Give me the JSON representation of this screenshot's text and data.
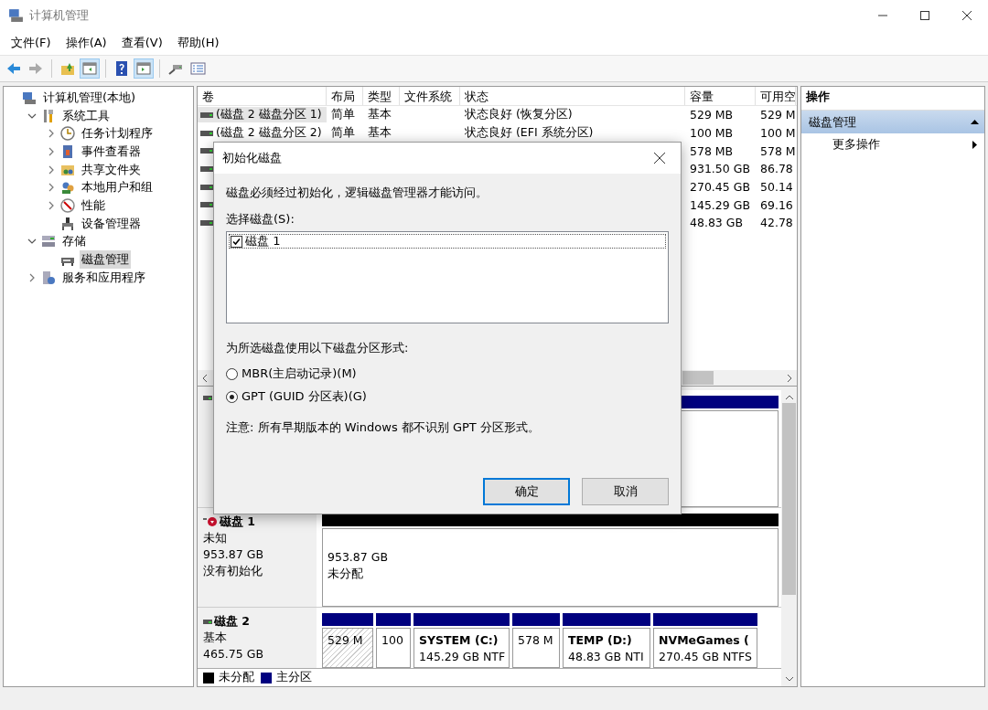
{
  "window": {
    "title": "计算机管理"
  },
  "menu": [
    "文件(F)",
    "操作(A)",
    "查看(V)",
    "帮助(H)"
  ],
  "toolbar": [
    {
      "disabled": false,
      "pressed": false
    },
    {
      "disabled": true,
      "pressed": false
    },
    {
      "disabled": false,
      "pressed": false
    },
    {
      "disabled": false,
      "pressed": true
    },
    {
      "disabled": false,
      "pressed": false
    },
    {
      "disabled": false,
      "pressed": true
    },
    {
      "disabled": false,
      "pressed": false
    },
    {
      "disabled": false,
      "pressed": false
    }
  ],
  "tree": [
    {
      "label": "计算机管理(本地)",
      "selected": false,
      "children": [
        {
          "label": "系统工具",
          "expanded": true,
          "selected": false,
          "children": [
            {
              "label": "任务计划程序",
              "expanded": false,
              "selected": false
            },
            {
              "label": "事件查看器",
              "expanded": false,
              "selected": false
            },
            {
              "label": "共享文件夹",
              "expanded": false,
              "selected": false
            },
            {
              "label": "本地用户和组",
              "expanded": false,
              "selected": false
            },
            {
              "label": "性能",
              "expanded": false,
              "selected": false
            },
            {
              "label": "设备管理器",
              "selected": false
            }
          ]
        },
        {
          "label": "存储",
          "expanded": true,
          "selected": false,
          "children": [
            {
              "label": "磁盘管理",
              "selected": true
            }
          ]
        },
        {
          "label": "服务和应用程序",
          "expanded": false,
          "selected": false
        }
      ]
    }
  ],
  "volumes": {
    "columns": [
      "卷",
      "布局",
      "类型",
      "文件系统",
      "状态",
      "容量",
      "可用空"
    ],
    "rows": [
      {
        "selected": true,
        "cells": [
          "(磁盘 2 磁盘分区 1)",
          "简单",
          "基本",
          "",
          "状态良好 (恢复分区)",
          "529 MB",
          "529 M"
        ]
      },
      {
        "selected": false,
        "cells": [
          "(磁盘 2 磁盘分区 2)",
          "简单",
          "基本",
          "",
          "状态良好 (EFI 系统分区)",
          "100 MB",
          "100 M"
        ]
      },
      {
        "selected": false,
        "cells": [
          "",
          "",
          "",
          "",
          "",
          "578 MB",
          "578 M"
        ]
      },
      {
        "selected": false,
        "cells": [
          "",
          "",
          "",
          "",
          "",
          "931.50 GB",
          "86.78"
        ]
      },
      {
        "selected": false,
        "cells": [
          "",
          "",
          "",
          "",
          "",
          "270.45 GB",
          "50.14"
        ]
      },
      {
        "selected": false,
        "cells": [
          "",
          "",
          "",
          "",
          "",
          "145.29 GB",
          "69.16"
        ]
      },
      {
        "selected": false,
        "cells": [
          "",
          "",
          "",
          "",
          "",
          "48.83 GB",
          "42.78"
        ]
      }
    ]
  },
  "disks": [
    {
      "kind": "basic",
      "partitions": [
        {
          "kind": "primary",
          "selected": false
        }
      ]
    },
    {
      "kind": "uninitialized",
      "name": "磁盘 1",
      "lines": [
        "未知",
        "953.87 GB",
        "没有初始化"
      ],
      "partitions": [
        {
          "kind": "unallocated",
          "selected": false,
          "lines": [
            "953.87 GB",
            "未分配"
          ]
        }
      ]
    },
    {
      "kind": "basic",
      "name": "磁盘 2",
      "lines": [
        "基本",
        "465.75 GB"
      ],
      "partitions": [
        {
          "kind": "primary",
          "selected": true,
          "lines": [
            "529 M"
          ]
        },
        {
          "kind": "primary",
          "selected": false,
          "lines": [
            "100"
          ]
        },
        {
          "kind": "primary",
          "selected": false,
          "title": "SYSTEM  (C:)",
          "lines": [
            "145.29 GB NTF"
          ]
        },
        {
          "kind": "primary",
          "selected": false,
          "lines": [
            "578 M"
          ]
        },
        {
          "kind": "primary",
          "selected": false,
          "title": "TEMP  (D:)",
          "lines": [
            "48.83 GB NTI"
          ]
        },
        {
          "kind": "primary",
          "selected": false,
          "title": "NVMeGames  (",
          "lines": [
            "270.45 GB NTFS"
          ]
        }
      ]
    }
  ],
  "legend": [
    {
      "label": "未分配",
      "color": "#000000"
    },
    {
      "label": "主分区",
      "color": "#00007f"
    }
  ],
  "actions": {
    "title": "操作",
    "section": {
      "label": "磁盘管理",
      "expanded": true
    },
    "items": [
      "更多操作"
    ]
  },
  "dialog": {
    "title": "初始化磁盘",
    "message": "磁盘必须经过初始化，逻辑磁盘管理器才能访问。",
    "list_label": "选择磁盘(S):",
    "disks": [
      {
        "label": "磁盘 1",
        "checked": true
      }
    ],
    "style_label": "为所选磁盘使用以下磁盘分区形式:",
    "styles": [
      {
        "label": "MBR(主启动记录)(M)",
        "selected": false
      },
      {
        "label": "GPT (GUID 分区表)(G)",
        "selected": true
      }
    ],
    "note": "注意: 所有早期版本的 Windows 都不识别 GPT 分区形式。",
    "buttons": [
      {
        "label": "确定",
        "default": true
      },
      {
        "label": "取消",
        "default": false
      }
    ]
  }
}
